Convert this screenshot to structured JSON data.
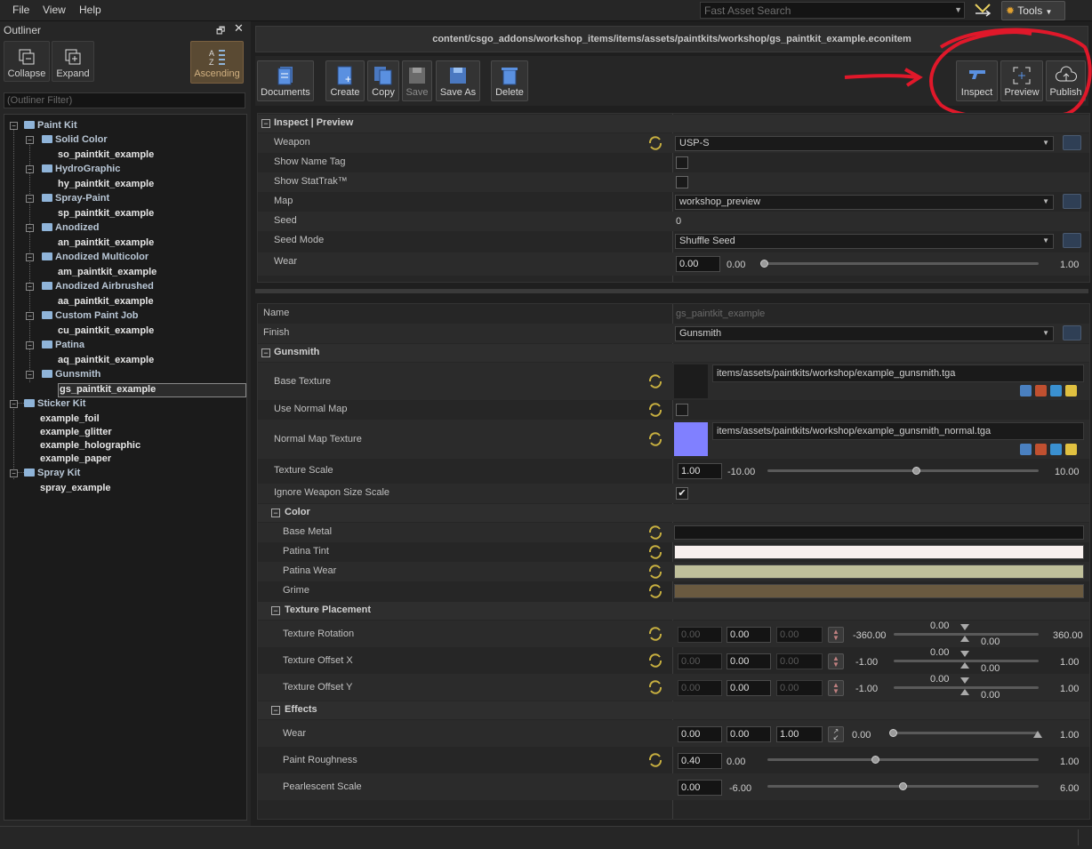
{
  "menu": {
    "file": "File",
    "view": "View",
    "help": "Help"
  },
  "search": {
    "placeholder": "Fast Asset Search"
  },
  "tools_label": "Tools",
  "outliner": {
    "title": "Outliner",
    "collapse": "Collapse",
    "expand": "Expand",
    "ascending": "Ascending",
    "filter_placeholder": "(Outliner Filter)",
    "paint_kit": "Paint Kit",
    "paint_kit_items": [
      {
        "cat": "Solid Color",
        "item": "so_paintkit_example"
      },
      {
        "cat": "HydroGraphic",
        "item": "hy_paintkit_example"
      },
      {
        "cat": "Spray-Paint",
        "item": "sp_paintkit_example"
      },
      {
        "cat": "Anodized",
        "item": "an_paintkit_example"
      },
      {
        "cat": "Anodized Multicolor",
        "item": "am_paintkit_example"
      },
      {
        "cat": "Anodized Airbrushed",
        "item": "aa_paintkit_example"
      },
      {
        "cat": "Custom Paint Job",
        "item": "cu_paintkit_example"
      },
      {
        "cat": "Patina",
        "item": "aq_paintkit_example"
      },
      {
        "cat": "Gunsmith",
        "item": "gs_paintkit_example"
      }
    ],
    "sticker_kit": "Sticker Kit",
    "sticker_items": [
      "example_foil",
      "example_glitter",
      "example_holographic",
      "example_paper"
    ],
    "spray_kit": "Spray Kit",
    "spray_items": [
      "spray_example"
    ]
  },
  "path": "content/csgo_addons/workshop_items/items/assets/paintkits/workshop/gs_paintkit_example.econitem",
  "toolbar": {
    "documents": "Documents",
    "create": "Create",
    "copy": "Copy",
    "save": "Save",
    "save_as": "Save As",
    "delete": "Delete",
    "inspect": "Inspect",
    "preview": "Preview",
    "publish": "Publish"
  },
  "inspect": {
    "section": "Inspect | Preview",
    "weapon_label": "Weapon",
    "weapon_value": "USP-S",
    "name_tag_label": "Show Name Tag",
    "stattrak_label": "Show StatTrak™",
    "map_label": "Map",
    "map_value": "workshop_preview",
    "seed_label": "Seed",
    "seed_value": "0",
    "seed_mode_label": "Seed Mode",
    "seed_mode_value": "Shuffle Seed",
    "wear_label": "Wear",
    "wear_value": "0.00",
    "wear_min": "0.00",
    "wear_max": "1.00",
    "wear_level": 0.0
  },
  "props": {
    "name_label": "Name",
    "name_value": "gs_paintkit_example",
    "finish_label": "Finish",
    "finish_value": "Gunsmith",
    "gunsmith_section": "Gunsmith",
    "base_texture_label": "Base Texture",
    "base_texture_value": "items/assets/paintkits/workshop/example_gunsmith.tga",
    "use_normal_label": "Use Normal Map",
    "normal_texture_label": "Normal Map Texture",
    "normal_texture_value": "items/assets/paintkits/workshop/example_gunsmith_normal.tga",
    "normal_color": "#8080ff",
    "texture_scale_label": "Texture Scale",
    "texture_scale_value": "1.00",
    "texture_scale_min": "-10.00",
    "texture_scale_max": "10.00",
    "texture_scale_level": 0.55,
    "ignore_size_label": "Ignore Weapon Size Scale",
    "ignore_size_check": "✔",
    "color_section": "Color",
    "colors": [
      {
        "label": "Base Metal",
        "color": "#151515"
      },
      {
        "label": "Patina Tint",
        "color": "#f8f0ee"
      },
      {
        "label": "Patina Wear",
        "color": "#bfbf9a"
      },
      {
        "label": "Grime",
        "color": "#6a5a40"
      }
    ],
    "placement_section": "Texture Placement",
    "placement": [
      {
        "label": "Texture Rotation",
        "v1": "0.00",
        "v2": "0.00",
        "v3": "0.00",
        "min": "-360.00",
        "max": "360.00",
        "top": "0.00",
        "bot": "0.00"
      },
      {
        "label": "Texture Offset X",
        "v1": "0.00",
        "v2": "0.00",
        "v3": "0.00",
        "min": "-1.00",
        "max": "1.00",
        "top": "0.00",
        "bot": "0.00"
      },
      {
        "label": "Texture Offset Y",
        "v1": "0.00",
        "v2": "0.00",
        "v3": "0.00",
        "min": "-1.00",
        "max": "1.00",
        "top": "0.00",
        "bot": "0.00"
      }
    ],
    "effects_section": "Effects",
    "wear_label": "Wear",
    "wear_v1": "0.00",
    "wear_v2": "0.00",
    "wear_v3": "1.00",
    "wear_min": "0.00",
    "wear_max": "1.00",
    "roughness_label": "Paint Roughness",
    "roughness_value": "0.40",
    "roughness_min": "0.00",
    "roughness_max": "1.00",
    "roughness_level": 0.4,
    "pearl_label": "Pearlescent Scale",
    "pearl_value": "0.00",
    "pearl_min": "-6.00",
    "pearl_max": "6.00",
    "pearl_level": 0.5
  },
  "colors": {
    "annotation_red": "#e0182a",
    "accent_orange": "#d0b080"
  }
}
